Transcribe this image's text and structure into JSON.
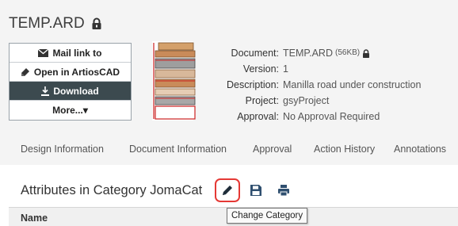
{
  "document_title": "TEMP.ARD",
  "actions": {
    "mail": "Mail link to",
    "open": "Open in ArtiosCAD",
    "download": "Download",
    "more": "More...▾"
  },
  "meta": {
    "document_label": "Document:",
    "document_value": "TEMP.ARD",
    "document_size": "(56KB)",
    "version_label": "Version:",
    "version_value": "1",
    "description_label": "Description:",
    "description_value": "Manilla road under construction",
    "project_label": "Project:",
    "project_value": "gsyProject",
    "approval_label": "Approval:",
    "approval_value": "No Approval Required"
  },
  "tabs": [
    "Design Information",
    "Document Information",
    "Approval",
    "Action History",
    "Annotations"
  ],
  "section": {
    "title": "Attributes in Category JomaCat",
    "tooltip": "Change Category"
  },
  "table": {
    "name_header": "Name"
  },
  "colors": {
    "dark_button": "#3c4a4f",
    "highlight": "#e53935",
    "icon": "#2f4f6f"
  }
}
